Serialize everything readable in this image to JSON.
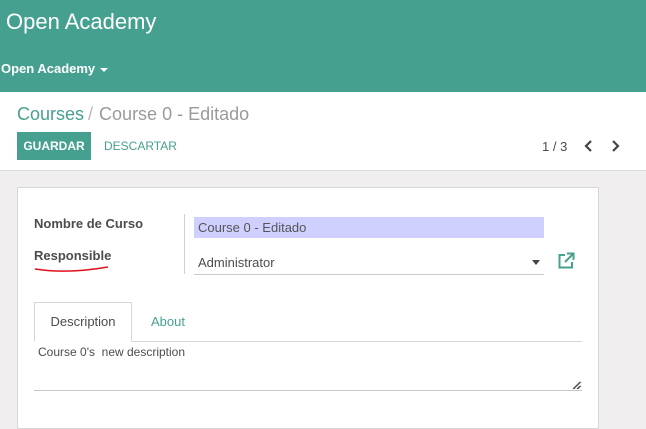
{
  "app": {
    "title": "Open Academy",
    "menu_label": "Open Academy"
  },
  "breadcrumb": {
    "parent": "Courses",
    "separator": "/",
    "current": "Course 0 - Editado"
  },
  "toolbar": {
    "save_label": "GUARDAR",
    "discard_label": "DESCARTAR"
  },
  "pager": {
    "text": "1 / 3"
  },
  "form": {
    "name_label": "Nombre de Curso",
    "name_value": "Course 0 - Editado",
    "responsible_label": "Responsible",
    "responsible_value": "Administrator"
  },
  "tabs": [
    {
      "label": "Description",
      "active": true
    },
    {
      "label": "About",
      "active": false
    }
  ],
  "description": {
    "value": "Course 0's  new description"
  },
  "colors": {
    "brand": "#46a08f",
    "input_highlight": "#cfd0ff",
    "annotation": "#e0101a"
  }
}
